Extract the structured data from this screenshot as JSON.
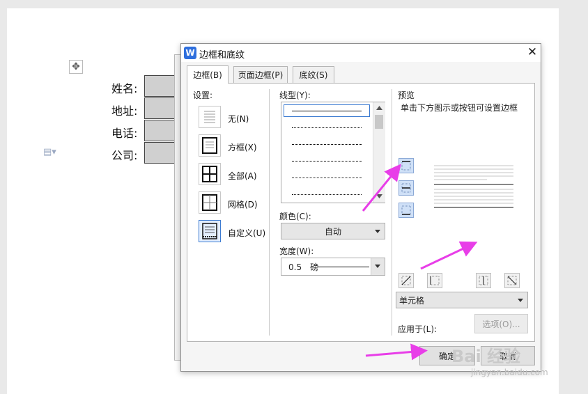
{
  "document": {
    "fields": [
      {
        "label": "姓名:"
      },
      {
        "label": "地址:"
      },
      {
        "label": "电话:"
      },
      {
        "label": "公司:"
      }
    ],
    "move_handle_glyph": "✥",
    "paragraph_glyph": "▤▾"
  },
  "dialog": {
    "title": "边框和底纹",
    "logo": "W",
    "close_glyph": "✕",
    "tabs": [
      {
        "label": "边框(B)",
        "active": true
      },
      {
        "label": "页面边框(P)",
        "active": false
      },
      {
        "label": "底纹(S)",
        "active": false
      }
    ],
    "settings": {
      "heading": "设置:",
      "items": [
        {
          "label": "无(N)",
          "selected": false
        },
        {
          "label": "方框(X)",
          "selected": false
        },
        {
          "label": "全部(A)",
          "selected": false
        },
        {
          "label": "网格(D)",
          "selected": false
        },
        {
          "label": "自定义(U)",
          "selected": true
        }
      ]
    },
    "line_style": {
      "heading": "线型(Y):",
      "color_label": "颜色(C):",
      "color_value": "自动",
      "width_label": "宽度(W):",
      "width_value": "0.5　磅"
    },
    "preview": {
      "heading": "预览",
      "hint": "单击下方图示或按钮可设置边框",
      "apply_label": "应用于(L):",
      "apply_value": "单元格",
      "options_button": "选项(O)..."
    },
    "ok_button": "确定",
    "cancel_button": "取消"
  },
  "watermark": {
    "logo": "Bai 经验",
    "url": "jingyan.baidu.com"
  },
  "colors": {
    "arrow": "#e83ee8",
    "accent": "#3c7bd1",
    "wps_blue": "#2f6fdd"
  }
}
